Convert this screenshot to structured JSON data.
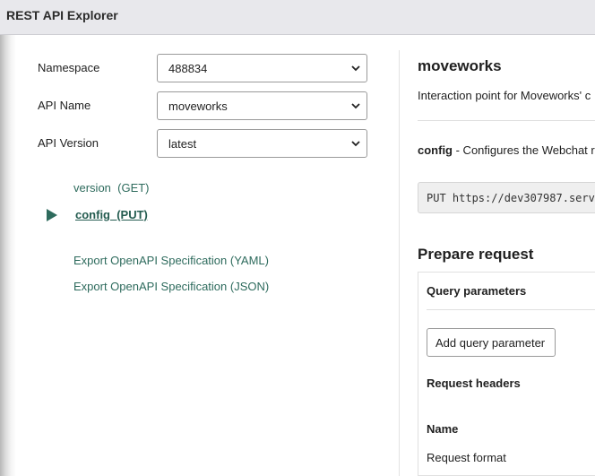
{
  "app": {
    "title": "REST API Explorer"
  },
  "form": {
    "namespace": {
      "label": "Namespace",
      "value": "488834"
    },
    "api_name": {
      "label": "API Name",
      "value": "moveworks"
    },
    "api_version": {
      "label": "API Version",
      "value": "latest"
    }
  },
  "endpoints": [
    {
      "label": "version  (GET)",
      "active": false
    },
    {
      "label": "config  (PUT)",
      "active": true
    }
  ],
  "exports": [
    {
      "label": "Export OpenAPI Specification (YAML)"
    },
    {
      "label": "Export OpenAPI Specification (JSON)"
    }
  ],
  "detail": {
    "title": "moveworks",
    "description": "Interaction point for Moveworks' c",
    "method_name": "config",
    "method_desc": " - Configures the Webchat r",
    "request_line": "PUT https://dev307987.serv"
  },
  "prepare": {
    "heading": "Prepare request",
    "query_params_label": "Query parameters",
    "add_query_button": "Add query parameter",
    "request_headers_label": "Request headers",
    "name_col": "Name",
    "request_format": "Request format"
  },
  "icons": {
    "select_chevron": "chevron-down-icon",
    "active_endpoint": "play-icon"
  }
}
